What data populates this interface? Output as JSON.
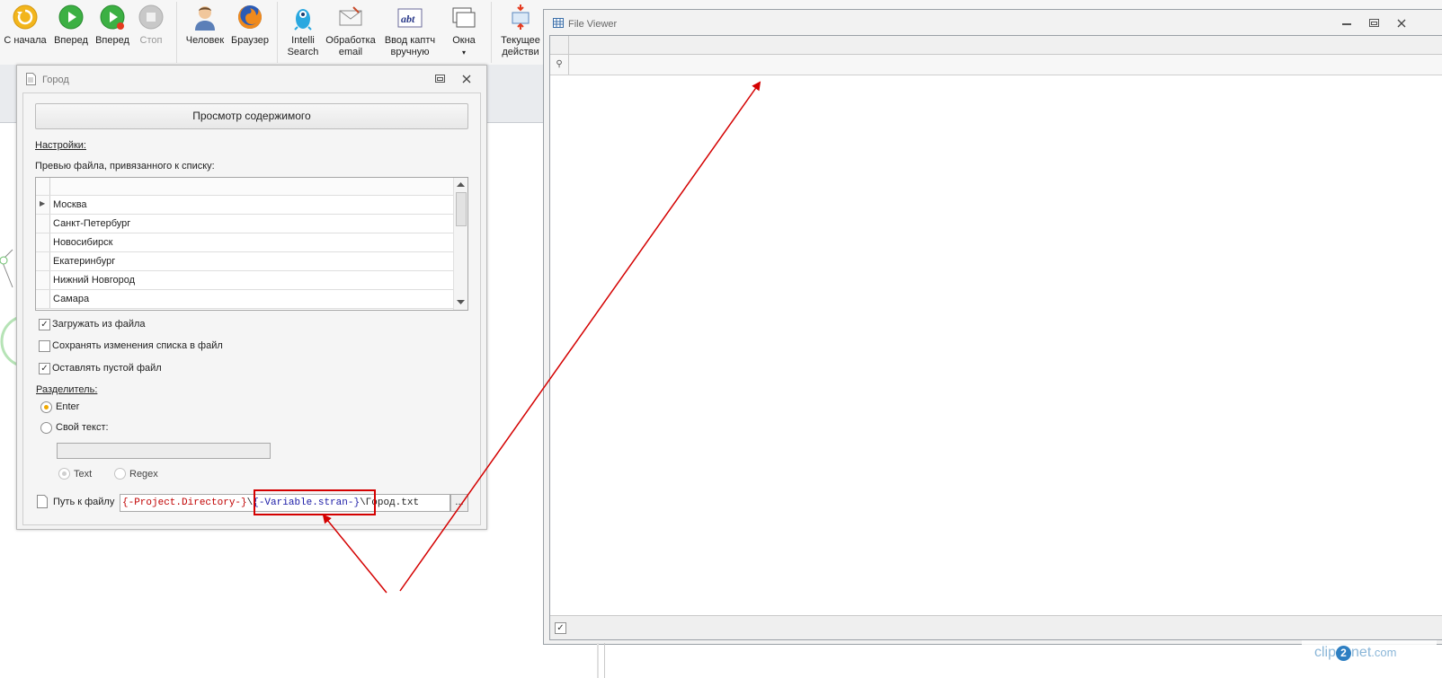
{
  "toolbar": {
    "start": "С начала",
    "forward1": "Вперед",
    "forward2": "Вперед",
    "stop": "Стоп",
    "human": "Человек",
    "browser": "Браузер",
    "intelli_line1": "Intelli",
    "intelli_line2": "Search",
    "email_line1": "Обработка",
    "email_line2": "email",
    "captcha_line1": "Ввод каптч",
    "captcha_line2": "вручную",
    "windows": "Окна",
    "current_line1": "Текущее",
    "current_line2": "действи"
  },
  "dialog": {
    "title": "Город",
    "preview_button": "Просмотр содержимого",
    "settings_link": "Настройки:",
    "preview_label": "Превью файла, привязанного к списку:",
    "cities": [
      "Москва",
      "Санкт-Петербург",
      "Новосибирск",
      "Екатеринбург",
      "Нижний Новгород",
      "Самара"
    ],
    "load_from_file": "Загружать из файла",
    "save_changes": "Сохранять изменения списка в файл",
    "keep_empty": "Оставлять пустой файл",
    "separator_link": "Разделитель:",
    "sep_enter": "Enter",
    "sep_custom": "Свой текст:",
    "mode_text": "Text",
    "mode_regex": "Regex",
    "path_label": "Путь к файлу",
    "path_part1": "{-Project.Directory-}",
    "path_sep": "\\",
    "path_part2": "{-Variable.stran-}",
    "path_rest": "\\Город.txt",
    "browse": "..."
  },
  "viewer": {
    "title": "File Viewer",
    "pin": "⚲",
    "check": "✓"
  },
  "watermark": {
    "a": "clip",
    "b": "2",
    "c": "net",
    "d": ".com"
  },
  "colors": {
    "highlight_box": "#d40000",
    "arrow": "#d40000",
    "radio_selected": "#f0a800",
    "path_brace": "#c00000",
    "path_name": "#1a1aa6",
    "path_field": "#2e8b2e"
  }
}
